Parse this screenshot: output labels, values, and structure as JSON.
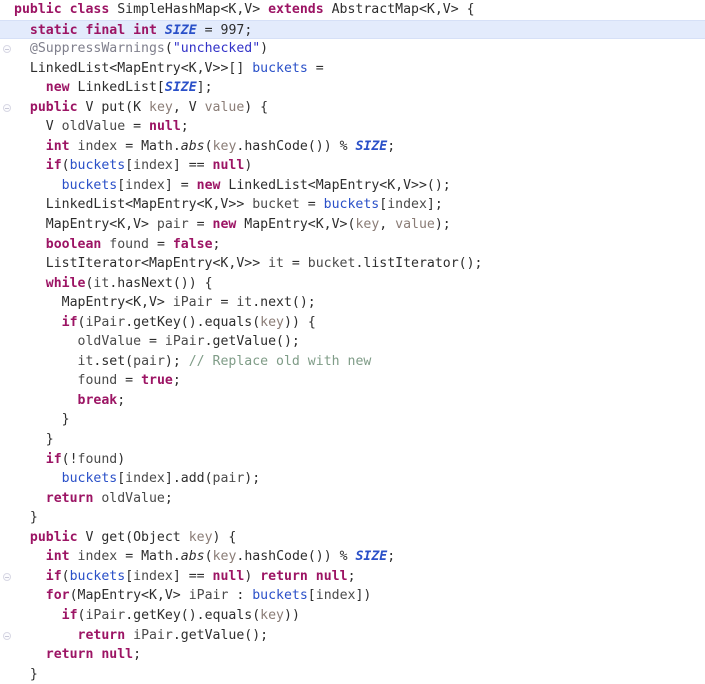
{
  "editor": {
    "language": "Java",
    "file_kind": "source-code",
    "font_size_px": 13,
    "line_height_px": 19.55,
    "highlighted_line_number": 2,
    "total_lines": 34,
    "colors": {
      "background": "#ffffff",
      "keyword": "#9c1464",
      "field": "#2a50c8",
      "static_constant": "#2a50c8",
      "string": "#3232c8",
      "comment": "#7f9c87",
      "annotation": "#7f7f8c",
      "parameter": "#8a7c76",
      "plain_text": "#2d2d2d",
      "current_line_highlight": "#e3ebfc"
    },
    "gutter": {
      "fold_marker_rows": [
        3,
        6,
        30,
        33
      ]
    }
  },
  "code": {
    "lines": [
      {
        "n": 1,
        "indent": 0,
        "tokens": [
          {
            "t": "public",
            "c": "kw"
          },
          {
            "t": " ",
            "c": "pl"
          },
          {
            "t": "class",
            "c": "kw"
          },
          {
            "t": " SimpleHashMap<K,V> ",
            "c": "pl"
          },
          {
            "t": "extends",
            "c": "kw"
          },
          {
            "t": " AbstractMap<K,V> {",
            "c": "pl"
          }
        ]
      },
      {
        "n": 2,
        "indent": 1,
        "highlight": true,
        "tokens": [
          {
            "t": "static",
            "c": "kw"
          },
          {
            "t": " ",
            "c": "pl"
          },
          {
            "t": "final",
            "c": "kw"
          },
          {
            "t": " ",
            "c": "pl"
          },
          {
            "t": "int",
            "c": "kw"
          },
          {
            "t": " ",
            "c": "pl"
          },
          {
            "t": "SIZE",
            "c": "cst"
          },
          {
            "t": " = ",
            "c": "pl"
          },
          {
            "t": "997",
            "c": "num"
          },
          {
            "t": ";",
            "c": "pl"
          }
        ]
      },
      {
        "n": 3,
        "indent": 1,
        "tokens": [
          {
            "t": "@SuppressWarnings",
            "c": "ann"
          },
          {
            "t": "(",
            "c": "pl"
          },
          {
            "t": "\"unchecked\"",
            "c": "str"
          },
          {
            "t": ")",
            "c": "pl"
          }
        ]
      },
      {
        "n": 4,
        "indent": 1,
        "tokens": [
          {
            "t": "LinkedList<MapEntry<K,V>>[] ",
            "c": "pl"
          },
          {
            "t": "buckets",
            "c": "fld"
          },
          {
            "t": " =",
            "c": "pl"
          }
        ]
      },
      {
        "n": 5,
        "indent": 2,
        "tokens": [
          {
            "t": "new",
            "c": "kw"
          },
          {
            "t": " LinkedList[",
            "c": "pl"
          },
          {
            "t": "SIZE",
            "c": "cst"
          },
          {
            "t": "];",
            "c": "pl"
          }
        ]
      },
      {
        "n": 6,
        "indent": 1,
        "tokens": [
          {
            "t": "public",
            "c": "kw"
          },
          {
            "t": " V put(K ",
            "c": "pl"
          },
          {
            "t": "key",
            "c": "par"
          },
          {
            "t": ", V ",
            "c": "pl"
          },
          {
            "t": "value",
            "c": "par"
          },
          {
            "t": ") {",
            "c": "pl"
          }
        ]
      },
      {
        "n": 7,
        "indent": 2,
        "tokens": [
          {
            "t": "V ",
            "c": "pl"
          },
          {
            "t": "oldValue",
            "c": "loc"
          },
          {
            "t": " = ",
            "c": "pl"
          },
          {
            "t": "null",
            "c": "kw"
          },
          {
            "t": ";",
            "c": "pl"
          }
        ]
      },
      {
        "n": 8,
        "indent": 2,
        "tokens": [
          {
            "t": "int",
            "c": "kw"
          },
          {
            "t": " ",
            "c": "pl"
          },
          {
            "t": "index",
            "c": "loc"
          },
          {
            "t": " = Math.",
            "c": "pl"
          },
          {
            "t": "abs",
            "c": "sfm"
          },
          {
            "t": "(",
            "c": "pl"
          },
          {
            "t": "key",
            "c": "par"
          },
          {
            "t": ".hashCode()) % ",
            "c": "pl"
          },
          {
            "t": "SIZE",
            "c": "cst"
          },
          {
            "t": ";",
            "c": "pl"
          }
        ]
      },
      {
        "n": 9,
        "indent": 2,
        "tokens": [
          {
            "t": "if",
            "c": "kw"
          },
          {
            "t": "(",
            "c": "pl"
          },
          {
            "t": "buckets",
            "c": "fld"
          },
          {
            "t": "[",
            "c": "pl"
          },
          {
            "t": "index",
            "c": "loc"
          },
          {
            "t": "] == ",
            "c": "pl"
          },
          {
            "t": "null",
            "c": "kw"
          },
          {
            "t": ")",
            "c": "pl"
          }
        ]
      },
      {
        "n": 10,
        "indent": 3,
        "tokens": [
          {
            "t": "buckets",
            "c": "fld"
          },
          {
            "t": "[",
            "c": "pl"
          },
          {
            "t": "index",
            "c": "loc"
          },
          {
            "t": "] = ",
            "c": "pl"
          },
          {
            "t": "new",
            "c": "kw"
          },
          {
            "t": " LinkedList<MapEntry<K,V>>();",
            "c": "pl"
          }
        ]
      },
      {
        "n": 11,
        "indent": 2,
        "tokens": [
          {
            "t": "LinkedList<MapEntry<K,V>> ",
            "c": "pl"
          },
          {
            "t": "bucket",
            "c": "loc"
          },
          {
            "t": " = ",
            "c": "pl"
          },
          {
            "t": "buckets",
            "c": "fld"
          },
          {
            "t": "[",
            "c": "pl"
          },
          {
            "t": "index",
            "c": "loc"
          },
          {
            "t": "];",
            "c": "pl"
          }
        ]
      },
      {
        "n": 12,
        "indent": 2,
        "tokens": [
          {
            "t": "MapEntry<K,V> ",
            "c": "pl"
          },
          {
            "t": "pair",
            "c": "loc"
          },
          {
            "t": " = ",
            "c": "pl"
          },
          {
            "t": "new",
            "c": "kw"
          },
          {
            "t": " MapEntry<K,V>(",
            "c": "pl"
          },
          {
            "t": "key",
            "c": "par"
          },
          {
            "t": ", ",
            "c": "pl"
          },
          {
            "t": "value",
            "c": "par"
          },
          {
            "t": ");",
            "c": "pl"
          }
        ]
      },
      {
        "n": 13,
        "indent": 2,
        "tokens": [
          {
            "t": "boolean",
            "c": "kw"
          },
          {
            "t": " ",
            "c": "pl"
          },
          {
            "t": "found",
            "c": "loc"
          },
          {
            "t": " = ",
            "c": "pl"
          },
          {
            "t": "false",
            "c": "kw"
          },
          {
            "t": ";",
            "c": "pl"
          }
        ]
      },
      {
        "n": 14,
        "indent": 2,
        "tokens": [
          {
            "t": "ListIterator<MapEntry<K,V>> ",
            "c": "pl"
          },
          {
            "t": "it",
            "c": "loc"
          },
          {
            "t": " = ",
            "c": "pl"
          },
          {
            "t": "bucket",
            "c": "loc"
          },
          {
            "t": ".listIterator();",
            "c": "pl"
          }
        ]
      },
      {
        "n": 15,
        "indent": 2,
        "tokens": [
          {
            "t": "while",
            "c": "kw"
          },
          {
            "t": "(",
            "c": "pl"
          },
          {
            "t": "it",
            "c": "loc"
          },
          {
            "t": ".hasNext()) {",
            "c": "pl"
          }
        ]
      },
      {
        "n": 16,
        "indent": 3,
        "tokens": [
          {
            "t": "MapEntry<K,V> ",
            "c": "pl"
          },
          {
            "t": "iPair",
            "c": "loc"
          },
          {
            "t": " = ",
            "c": "pl"
          },
          {
            "t": "it",
            "c": "loc"
          },
          {
            "t": ".next();",
            "c": "pl"
          }
        ]
      },
      {
        "n": 17,
        "indent": 3,
        "tokens": [
          {
            "t": "if",
            "c": "kw"
          },
          {
            "t": "(",
            "c": "pl"
          },
          {
            "t": "iPair",
            "c": "loc"
          },
          {
            "t": ".getKey().equals(",
            "c": "pl"
          },
          {
            "t": "key",
            "c": "par"
          },
          {
            "t": ")) {",
            "c": "pl"
          }
        ]
      },
      {
        "n": 18,
        "indent": 4,
        "tokens": [
          {
            "t": "oldValue",
            "c": "loc"
          },
          {
            "t": " = ",
            "c": "pl"
          },
          {
            "t": "iPair",
            "c": "loc"
          },
          {
            "t": ".getValue();",
            "c": "pl"
          }
        ]
      },
      {
        "n": 19,
        "indent": 4,
        "tokens": [
          {
            "t": "it",
            "c": "loc"
          },
          {
            "t": ".set(",
            "c": "pl"
          },
          {
            "t": "pair",
            "c": "loc"
          },
          {
            "t": "); ",
            "c": "pl"
          },
          {
            "t": "// Replace old with new",
            "c": "cmt"
          }
        ]
      },
      {
        "n": 20,
        "indent": 4,
        "tokens": [
          {
            "t": "found",
            "c": "loc"
          },
          {
            "t": " = ",
            "c": "pl"
          },
          {
            "t": "true",
            "c": "kw"
          },
          {
            "t": ";",
            "c": "pl"
          }
        ]
      },
      {
        "n": 21,
        "indent": 4,
        "tokens": [
          {
            "t": "break",
            "c": "kw"
          },
          {
            "t": ";",
            "c": "pl"
          }
        ]
      },
      {
        "n": 22,
        "indent": 3,
        "tokens": [
          {
            "t": "}",
            "c": "pl"
          }
        ]
      },
      {
        "n": 23,
        "indent": 2,
        "tokens": [
          {
            "t": "}",
            "c": "pl"
          }
        ]
      },
      {
        "n": 24,
        "indent": 2,
        "tokens": [
          {
            "t": "if",
            "c": "kw"
          },
          {
            "t": "(!",
            "c": "pl"
          },
          {
            "t": "found",
            "c": "loc"
          },
          {
            "t": ")",
            "c": "pl"
          }
        ]
      },
      {
        "n": 25,
        "indent": 3,
        "tokens": [
          {
            "t": "buckets",
            "c": "fld"
          },
          {
            "t": "[",
            "c": "pl"
          },
          {
            "t": "index",
            "c": "loc"
          },
          {
            "t": "].add(",
            "c": "pl"
          },
          {
            "t": "pair",
            "c": "loc"
          },
          {
            "t": ");",
            "c": "pl"
          }
        ]
      },
      {
        "n": 26,
        "indent": 2,
        "tokens": [
          {
            "t": "return",
            "c": "kw"
          },
          {
            "t": " ",
            "c": "pl"
          },
          {
            "t": "oldValue",
            "c": "loc"
          },
          {
            "t": ";",
            "c": "pl"
          }
        ]
      },
      {
        "n": 27,
        "indent": 1,
        "tokens": [
          {
            "t": "}",
            "c": "pl"
          }
        ]
      },
      {
        "n": 28,
        "indent": 1,
        "tokens": [
          {
            "t": "public",
            "c": "kw"
          },
          {
            "t": " V get(Object ",
            "c": "pl"
          },
          {
            "t": "key",
            "c": "par"
          },
          {
            "t": ") {",
            "c": "pl"
          }
        ]
      },
      {
        "n": 29,
        "indent": 2,
        "tokens": [
          {
            "t": "int",
            "c": "kw"
          },
          {
            "t": " ",
            "c": "pl"
          },
          {
            "t": "index",
            "c": "loc"
          },
          {
            "t": " = Math.",
            "c": "pl"
          },
          {
            "t": "abs",
            "c": "sfm"
          },
          {
            "t": "(",
            "c": "pl"
          },
          {
            "t": "key",
            "c": "par"
          },
          {
            "t": ".hashCode()) % ",
            "c": "pl"
          },
          {
            "t": "SIZE",
            "c": "cst"
          },
          {
            "t": ";",
            "c": "pl"
          }
        ]
      },
      {
        "n": 30,
        "indent": 2,
        "tokens": [
          {
            "t": "if",
            "c": "kw"
          },
          {
            "t": "(",
            "c": "pl"
          },
          {
            "t": "buckets",
            "c": "fld"
          },
          {
            "t": "[",
            "c": "pl"
          },
          {
            "t": "index",
            "c": "loc"
          },
          {
            "t": "] == ",
            "c": "pl"
          },
          {
            "t": "null",
            "c": "kw"
          },
          {
            "t": ") ",
            "c": "pl"
          },
          {
            "t": "return",
            "c": "kw"
          },
          {
            "t": " ",
            "c": "pl"
          },
          {
            "t": "null",
            "c": "kw"
          },
          {
            "t": ";",
            "c": "pl"
          }
        ]
      },
      {
        "n": 31,
        "indent": 2,
        "tokens": [
          {
            "t": "for",
            "c": "kw"
          },
          {
            "t": "(MapEntry<K,V> ",
            "c": "pl"
          },
          {
            "t": "iPair",
            "c": "loc"
          },
          {
            "t": " : ",
            "c": "pl"
          },
          {
            "t": "buckets",
            "c": "fld"
          },
          {
            "t": "[",
            "c": "pl"
          },
          {
            "t": "index",
            "c": "loc"
          },
          {
            "t": "])",
            "c": "pl"
          }
        ]
      },
      {
        "n": 32,
        "indent": 3,
        "tokens": [
          {
            "t": "if",
            "c": "kw"
          },
          {
            "t": "(",
            "c": "pl"
          },
          {
            "t": "iPair",
            "c": "loc"
          },
          {
            "t": ".getKey().equals(",
            "c": "pl"
          },
          {
            "t": "key",
            "c": "par"
          },
          {
            "t": "))",
            "c": "pl"
          }
        ]
      },
      {
        "n": 33,
        "indent": 4,
        "tokens": [
          {
            "t": "return",
            "c": "kw"
          },
          {
            "t": " ",
            "c": "pl"
          },
          {
            "t": "iPair",
            "c": "loc"
          },
          {
            "t": ".getValue();",
            "c": "pl"
          }
        ]
      },
      {
        "n": 34,
        "indent": 2,
        "tokens": [
          {
            "t": "return",
            "c": "kw"
          },
          {
            "t": " ",
            "c": "pl"
          },
          {
            "t": "null",
            "c": "kw"
          },
          {
            "t": ";",
            "c": "pl"
          }
        ]
      },
      {
        "n": 35,
        "indent": 1,
        "tokens": [
          {
            "t": "}",
            "c": "pl"
          }
        ]
      }
    ]
  }
}
